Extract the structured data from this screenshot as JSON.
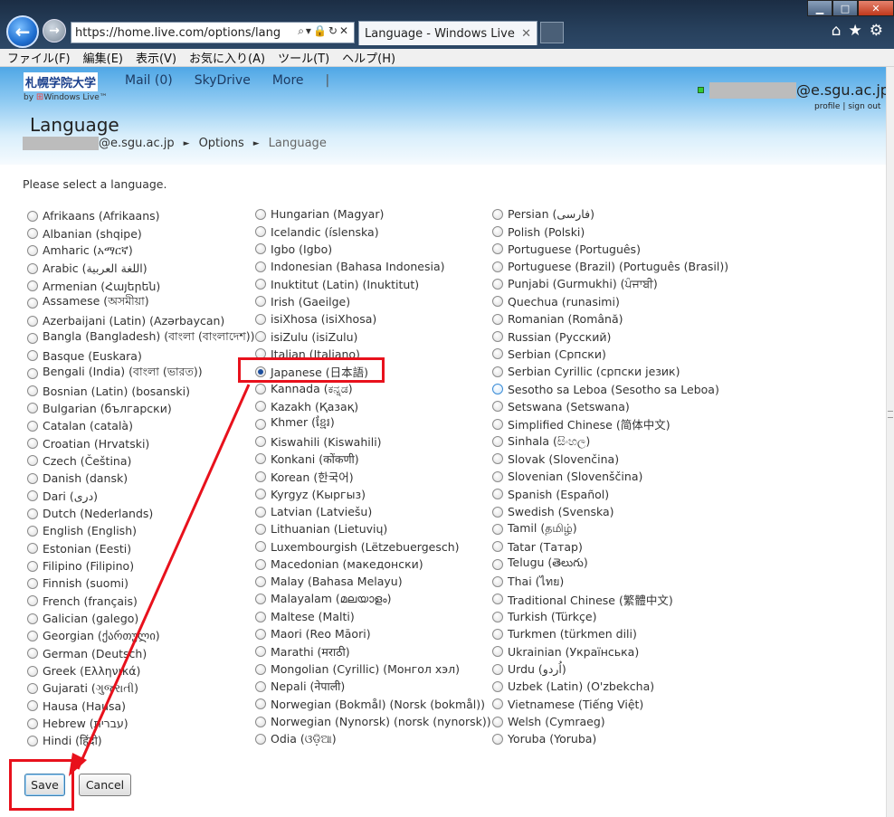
{
  "browser": {
    "address_url": "https://home.live.com/options/lang",
    "tab_title": "Language - Windows Live",
    "menu": [
      "ファイル(F)",
      "編集(E)",
      "表示(V)",
      "お気に入り(A)",
      "ツール(T)",
      "ヘルプ(H)"
    ]
  },
  "header": {
    "logo_text": "札幌学院大学",
    "by_text": "by",
    "windows_live_text": "Windows Live™",
    "nav": [
      "Mail (0)",
      "SkyDrive",
      "More",
      "|"
    ],
    "account_domain": "@e.sgu.ac.jp",
    "account_menu_glyph": "▾",
    "profile_link": "profile",
    "link_sep": "|",
    "signout_link": "sign out"
  },
  "page": {
    "title": "Language",
    "breadcrumb": {
      "account": "@e.sgu.ac.jp",
      "options": "Options",
      "current": "Language",
      "separator": "►"
    },
    "prompt": "Please select a language.",
    "save_label": "Save",
    "cancel_label": "Cancel"
  },
  "languages": {
    "col1": [
      "Afrikaans (Afrikaans)",
      "Albanian (shqipe)",
      "Amharic (አማርኛ)",
      "Arabic (اللغة العربية)",
      "Armenian (Հայերեն)",
      "Assamese (অসমীয়া)",
      "Azerbaijani (Latin) (Azərbaycan)",
      "Bangla (Bangladesh) (বাংলা (বাংলাদেশ))",
      "Basque (Euskara)",
      "Bengali (India) (বাংলা (ভারত))",
      "Bosnian (Latin) (bosanski)",
      "Bulgarian (български)",
      "Catalan (català)",
      "Croatian (Hrvatski)",
      "Czech (Čeština)",
      "Danish (dansk)",
      "Dari (درى)",
      "Dutch (Nederlands)",
      "English (English)",
      "Estonian (Eesti)",
      "Filipino (Filipino)",
      "Finnish (suomi)",
      "French (français)",
      "Galician (galego)",
      "Georgian (ქართული)",
      "German (Deutsch)",
      "Greek (Ελληνικά)",
      "Gujarati (ગુજરાતી)",
      "Hausa (Hausa)",
      "Hebrew (עברית)",
      "Hindi (हिंदी)"
    ],
    "col2": [
      "Hungarian (Magyar)",
      "Icelandic (íslenska)",
      "Igbo (Igbo)",
      "Indonesian (Bahasa Indonesia)",
      "Inuktitut (Latin) (Inuktitut)",
      "Irish (Gaeilge)",
      "isiXhosa (isiXhosa)",
      "isiZulu (isiZulu)",
      "Italian (Italiano)",
      "Japanese (日本語)",
      "Kannada (ಕನ್ನಡ)",
      "Kazakh (Қазақ)",
      "Khmer (ខ្មែរ)",
      "Kiswahili (Kiswahili)",
      "Konkani (कोंकणी)",
      "Korean (한국어)",
      "Kyrgyz (Кыргыз)",
      "Latvian (Latviešu)",
      "Lithuanian (Lietuvių)",
      "Luxembourgish (Lëtzebuergesch)",
      "Macedonian (македонски)",
      "Malay (Bahasa Melayu)",
      "Malayalam (മലയാളം)",
      "Maltese (Malti)",
      "Maori (Reo Māori)",
      "Marathi (मराठी)",
      "Mongolian (Cyrillic) (Монгол хэл)",
      "Nepali (नेपाली)",
      "Norwegian (Bokmål) (Norsk (bokmål))",
      "Norwegian (Nynorsk) (norsk (nynorsk))",
      "Odia (ଓଡ଼ିଆ)"
    ],
    "col3": [
      "Persian (فارسى)",
      "Polish (Polski)",
      "Portuguese (Português)",
      "Portuguese (Brazil) (Português (Brasil))",
      "Punjabi (Gurmukhi) (ਪੰਜਾਬੀ)",
      "Quechua (runasimi)",
      "Romanian (Română)",
      "Russian (Русский)",
      "Serbian (Српски)",
      "Serbian Cyrillic (српски језик)",
      "Sesotho sa Leboa (Sesotho sa Leboa)",
      "Setswana (Setswana)",
      "Simplified Chinese (简体中文)",
      "Sinhala (සිංහල)",
      "Slovak (Slovenčina)",
      "Slovenian (Slovenščina)",
      "Spanish (Español)",
      "Swedish (Svenska)",
      "Tamil (தமிழ்)",
      "Tatar (Татар)",
      "Telugu (తెలుగు)",
      "Thai (ไทย)",
      "Traditional Chinese (繁體中文)",
      "Turkish (Türkçe)",
      "Turkmen (türkmen dili)",
      "Ukrainian (Українська)",
      "Urdu (اُردو)",
      "Uzbek (Latin) (O'zbekcha)",
      "Vietnamese (Tiếng Việt)",
      "Welsh (Cymraeg)",
      "Yoruba (Yoruba)"
    ],
    "selected": "Japanese (日本語)",
    "hovered": "Sesotho sa Leboa (Sesotho sa Leboa)"
  },
  "colors": {
    "annotation": "#e8111c",
    "selected_radio": "#1c4e9c"
  },
  "icons": {
    "back": "back-arrow-icon",
    "forward": "forward-arrow-icon",
    "home": "home-icon",
    "favorites": "star-icon",
    "tools": "gear-icon"
  }
}
